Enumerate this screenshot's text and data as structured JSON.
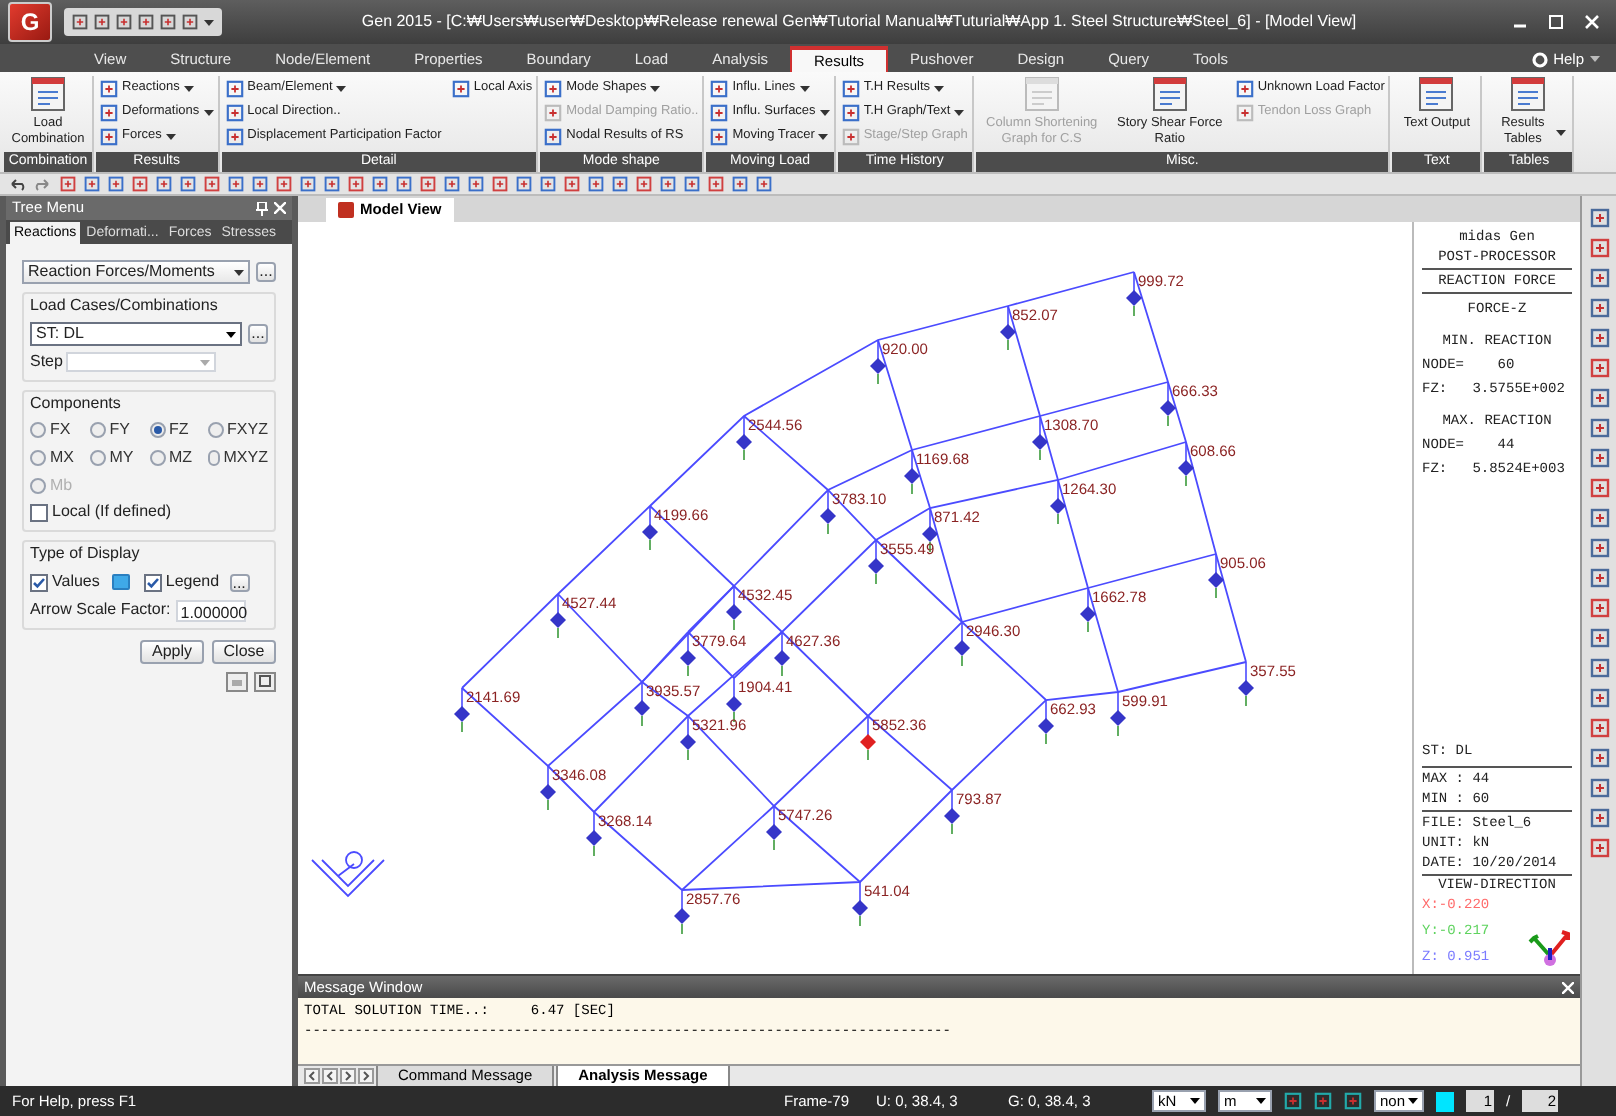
{
  "window": {
    "logo": "G",
    "title": "Gen 2015 - [C:₩Users₩user₩Desktop₩Release renewal Gen₩Tutorial Manual₩Tuturial₩App 1. Steel Structure₩Steel_6] - [Model View]"
  },
  "menu_tabs": [
    {
      "label": "View",
      "selected": false
    },
    {
      "label": "Structure",
      "selected": false
    },
    {
      "label": "Node/Element",
      "selected": false
    },
    {
      "label": "Properties",
      "selected": false
    },
    {
      "label": "Boundary",
      "selected": false
    },
    {
      "label": "Load",
      "selected": false
    },
    {
      "label": "Analysis",
      "selected": false
    },
    {
      "label": "Results",
      "selected": true
    },
    {
      "label": "Pushover",
      "selected": false
    },
    {
      "label": "Design",
      "selected": false
    },
    {
      "label": "Query",
      "selected": false
    },
    {
      "label": "Tools",
      "selected": false
    }
  ],
  "help": "Help",
  "ribbon": [
    {
      "label": "Combination",
      "items": [
        {
          "label": "Load Combination",
          "kind": "large",
          "dropdown": false,
          "disabled": false
        }
      ]
    },
    {
      "label": "Results",
      "items": [
        {
          "label": "Reactions",
          "kind": "small",
          "dropdown": true,
          "disabled": false
        },
        {
          "label": "Deformations",
          "kind": "small",
          "dropdown": true,
          "disabled": false
        },
        {
          "label": "Forces",
          "kind": "small",
          "dropdown": true,
          "disabled": false
        }
      ]
    },
    {
      "label": "Detail",
      "items": [
        {
          "label": "Beam/Element",
          "kind": "small",
          "dropdown": true,
          "disabled": false
        },
        {
          "label": "Local Direction..",
          "kind": "small",
          "dropdown": false,
          "disabled": false
        },
        {
          "label": "Displacement Participation Factor",
          "kind": "small",
          "dropdown": false,
          "disabled": false
        },
        {
          "label": "Local Axis",
          "kind": "small",
          "dropdown": false,
          "disabled": false
        }
      ]
    },
    {
      "label": "Mode shape",
      "items": [
        {
          "label": "Mode Shapes",
          "kind": "small",
          "dropdown": true,
          "disabled": false
        },
        {
          "label": "Modal Damping Ratio..",
          "kind": "small",
          "dropdown": false,
          "disabled": true
        },
        {
          "label": "Nodal Results of RS",
          "kind": "small",
          "dropdown": false,
          "disabled": false
        }
      ]
    },
    {
      "label": "Moving Load",
      "items": [
        {
          "label": "Influ. Lines",
          "kind": "small",
          "dropdown": true,
          "disabled": false
        },
        {
          "label": "Influ. Surfaces",
          "kind": "small",
          "dropdown": true,
          "disabled": false
        },
        {
          "label": "Moving Tracer",
          "kind": "small",
          "dropdown": true,
          "disabled": false
        }
      ]
    },
    {
      "label": "Time History",
      "items": [
        {
          "label": "T.H Results",
          "kind": "small",
          "dropdown": true,
          "disabled": false
        },
        {
          "label": "T.H Graph/Text",
          "kind": "small",
          "dropdown": true,
          "disabled": false
        },
        {
          "label": "Stage/Step Graph",
          "kind": "small",
          "dropdown": false,
          "disabled": true
        }
      ]
    },
    {
      "label": "Misc.",
      "items": [
        {
          "label": "Column Shortening Graph for C.S",
          "kind": "large",
          "dropdown": false,
          "disabled": true
        },
        {
          "label": "Story Shear Force Ratio",
          "kind": "large",
          "dropdown": false,
          "disabled": false
        },
        {
          "label": "Unknown Load Factor",
          "kind": "small",
          "dropdown": false,
          "disabled": false
        },
        {
          "label": "Tendon Loss Graph",
          "kind": "small",
          "dropdown": false,
          "disabled": true
        }
      ]
    },
    {
      "label": "Text",
      "items": [
        {
          "label": "Text Output",
          "kind": "large",
          "dropdown": false,
          "disabled": false
        }
      ]
    },
    {
      "label": "Tables",
      "items": [
        {
          "label": "Results Tables",
          "kind": "large",
          "dropdown": true,
          "disabled": false
        }
      ]
    }
  ],
  "tree": {
    "title": "Tree Menu",
    "tabs": [
      {
        "label": "Reactions",
        "selected": true
      },
      {
        "label": "Deformati...",
        "selected": false
      },
      {
        "label": "Forces",
        "selected": false
      },
      {
        "label": "Stresses",
        "selected": false
      }
    ],
    "result_type": "Reaction Forces/Moments",
    "more": "...",
    "load_cases": {
      "title": "Load Cases/Combinations",
      "value": "ST: DL",
      "more": "...",
      "step_label": "Step"
    },
    "components": {
      "title": "Components",
      "options": [
        {
          "label": "FX",
          "selected": false,
          "disabled": false
        },
        {
          "label": "FY",
          "selected": false,
          "disabled": false
        },
        {
          "label": "FZ",
          "selected": true,
          "disabled": false
        },
        {
          "label": "FXYZ",
          "selected": false,
          "disabled": false
        },
        {
          "label": "MX",
          "selected": false,
          "disabled": false
        },
        {
          "label": "MY",
          "selected": false,
          "disabled": false
        },
        {
          "label": "MZ",
          "selected": false,
          "disabled": false
        },
        {
          "label": "MXYZ",
          "selected": false,
          "disabled": false
        },
        {
          "label": "Mb",
          "selected": false,
          "disabled": true
        }
      ],
      "local": {
        "label": "Local (If defined)",
        "checked": false
      }
    },
    "display": {
      "title": "Type of Display",
      "values": {
        "label": "Values",
        "checked": true
      },
      "legend": {
        "label": "Legend",
        "checked": true,
        "more": "..."
      },
      "scale_label": "Arrow Scale Factor:",
      "scale_value": "1.000000"
    },
    "buttons": [
      "Apply",
      "Close"
    ]
  },
  "model_view": {
    "tab": "Model View",
    "nodes": [
      {
        "value": "999.72",
        "maximum": false
      },
      {
        "value": "852.07",
        "maximum": false
      },
      {
        "value": "920.00",
        "maximum": false
      },
      {
        "value": "666.33",
        "maximum": false
      },
      {
        "value": "1308.70",
        "maximum": false
      },
      {
        "value": "2544.56",
        "maximum": false
      },
      {
        "value": "1169.68",
        "maximum": false
      },
      {
        "value": "608.66",
        "maximum": false
      },
      {
        "value": "1264.30",
        "maximum": false
      },
      {
        "value": "3783.10",
        "maximum": false
      },
      {
        "value": "871.42",
        "maximum": false
      },
      {
        "value": "4199.66",
        "maximum": false
      },
      {
        "value": "3555.49",
        "maximum": false
      },
      {
        "value": "905.06",
        "maximum": false
      },
      {
        "value": "4527.44",
        "maximum": false
      },
      {
        "value": "4532.45",
        "maximum": false
      },
      {
        "value": "1662.78",
        "maximum": false
      },
      {
        "value": "2946.30",
        "maximum": false
      },
      {
        "value": "3779.64",
        "maximum": false
      },
      {
        "value": "4627.36",
        "maximum": false
      },
      {
        "value": "3935.57",
        "maximum": false
      },
      {
        "value": "1904.41",
        "maximum": false
      },
      {
        "value": "357.55",
        "maximum": false
      },
      {
        "value": "2141.69",
        "maximum": false
      },
      {
        "value": "599.91",
        "maximum": false
      },
      {
        "value": "662.93",
        "maximum": false
      },
      {
        "value": "5321.96",
        "maximum": false
      },
      {
        "value": "5852.36",
        "maximum": true
      },
      {
        "value": "3346.08",
        "maximum": false
      },
      {
        "value": "793.87",
        "maximum": false
      },
      {
        "value": "3268.14",
        "maximum": false
      },
      {
        "value": "5747.26",
        "maximum": false
      },
      {
        "value": "2857.76",
        "maximum": false
      },
      {
        "value": "541.04",
        "maximum": false
      }
    ]
  },
  "legend": {
    "app": "midas Gen",
    "module": "POST-PROCESSOR",
    "result": "REACTION FORCE",
    "component": "FORCE-Z",
    "extremes": [
      {
        "title": "MIN. REACTION",
        "node": "NODE=    60",
        "value": "FZ:   3.5755E+002"
      },
      {
        "title": "MAX. REACTION",
        "node": "NODE=    44",
        "value": "FZ:   5.8524E+003"
      }
    ],
    "load_case": "ST: DL",
    "max": "MAX : 44",
    "min": "MIN : 60",
    "file": "FILE: Steel_6",
    "unit": "UNIT: kN",
    "date": "DATE: 10/20/2014",
    "view_title": "VIEW-DIRECTION",
    "directions": [
      {
        "text": "X:-0.220",
        "color": "#ff6b6b"
      },
      {
        "text": "Y:-0.217",
        "color": "#5fd35f"
      },
      {
        "text": "Z: 0.951",
        "color": "#7b7bff"
      }
    ]
  },
  "message_window": {
    "title": "Message Window",
    "lines": [
      "TOTAL SOLUTION TIME..:     6.47 [SEC]",
      "-----------------------------------------------------------------------------"
    ],
    "tabs": [
      {
        "label": "Command Message",
        "selected": false
      },
      {
        "label": "Analysis Message",
        "selected": true
      }
    ]
  },
  "status_bar": {
    "help": "For Help, press F1",
    "frame": "Frame-79",
    "u": "U: 0, 38.4, 3",
    "g": "G: 0, 38.4, 3",
    "force_unit": "kN",
    "length_unit": "m",
    "mode": "non",
    "page": "1",
    "separator": "/",
    "pages": "2"
  }
}
